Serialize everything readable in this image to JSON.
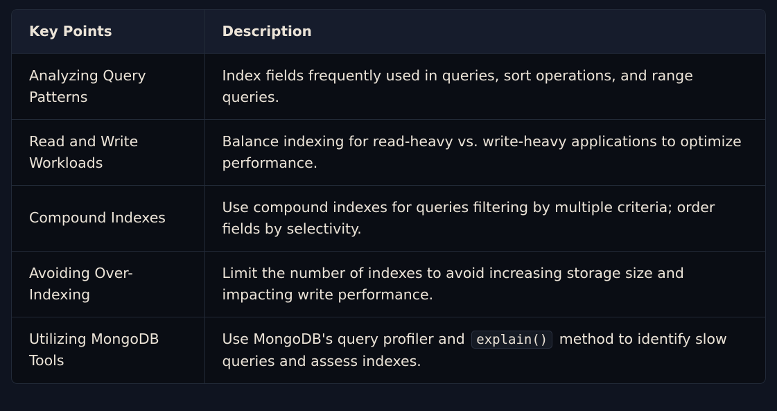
{
  "table": {
    "headers": [
      "Key Points",
      "Description"
    ],
    "rows": [
      {
        "key": "Analyzing Query Patterns",
        "desc": "Index fields frequently used in queries, sort operations, and range queries."
      },
      {
        "key": "Read and Write Workloads",
        "desc": "Balance indexing for read-heavy vs. write-heavy applications to optimize performance."
      },
      {
        "key": "Compound Indexes",
        "desc": "Use compound indexes for queries filtering by multiple criteria; order fields by selectivity."
      },
      {
        "key": "Avoiding Over-Indexing",
        "desc": "Limit the number of indexes to avoid increasing storage size and impacting write performance."
      },
      {
        "key": "Utilizing MongoDB Tools",
        "desc_before": "Use MongoDB's query profiler and",
        "desc_code": "explain()",
        "desc_after": "method to identify slow queries and assess indexes."
      }
    ]
  }
}
